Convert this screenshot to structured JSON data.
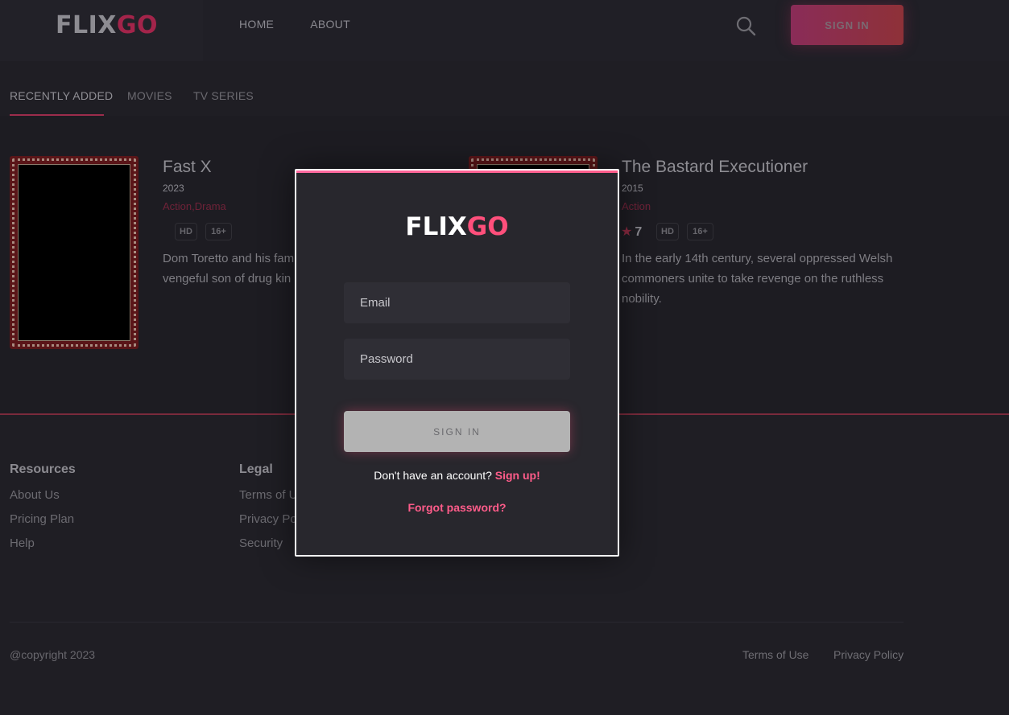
{
  "brand": {
    "logo_part1": "FLIX",
    "logo_part2": "GO"
  },
  "header": {
    "nav": [
      "HOME",
      "ABOUT"
    ],
    "search_icon": "search-icon",
    "signin_label": "SIGN IN"
  },
  "tabs": [
    {
      "label": "RECENTLY ADDED",
      "active": true
    },
    {
      "label": "MOVIES",
      "active": false
    },
    {
      "label": "TV SERIES",
      "active": false
    }
  ],
  "cards": [
    {
      "title": "Fast X",
      "year": "2023",
      "genres": "Action,Drama",
      "badges": [
        "HD",
        "16+"
      ],
      "description_lines": [
        "Dom Toretto and his fam",
        "vengeful son of drug kin"
      ]
    },
    {
      "title": "The Bastard Executioner",
      "year": "2015",
      "genres": "Action",
      "rating": "7",
      "badges": [
        "HD",
        "16+"
      ],
      "description_lines": [
        "In the early 14th century, several oppressed Welsh",
        "commoners unite to take revenge on the ruthless",
        "nobility."
      ]
    }
  ],
  "footer": {
    "columns": [
      {
        "heading": "Resources",
        "links": [
          "About Us",
          "Pricing Plan",
          "Help"
        ]
      },
      {
        "heading": "Legal",
        "links": [
          "Terms of U",
          "Privacy Po",
          "Security"
        ]
      }
    ],
    "copyright": "@copyright 2023",
    "bottom_links": [
      "Terms of Use",
      "Privacy Policy"
    ]
  },
  "modal": {
    "email_placeholder": "Email",
    "password_placeholder": "Password",
    "signin_label": "SIGN IN",
    "account_text": "Don't have an account?",
    "signup_link": "Sign up!",
    "forgot_link": "Forgot password?"
  },
  "colors": {
    "accent": "#ff5c8a",
    "background": "#1d1c22",
    "modal_bg": "#28272d"
  }
}
